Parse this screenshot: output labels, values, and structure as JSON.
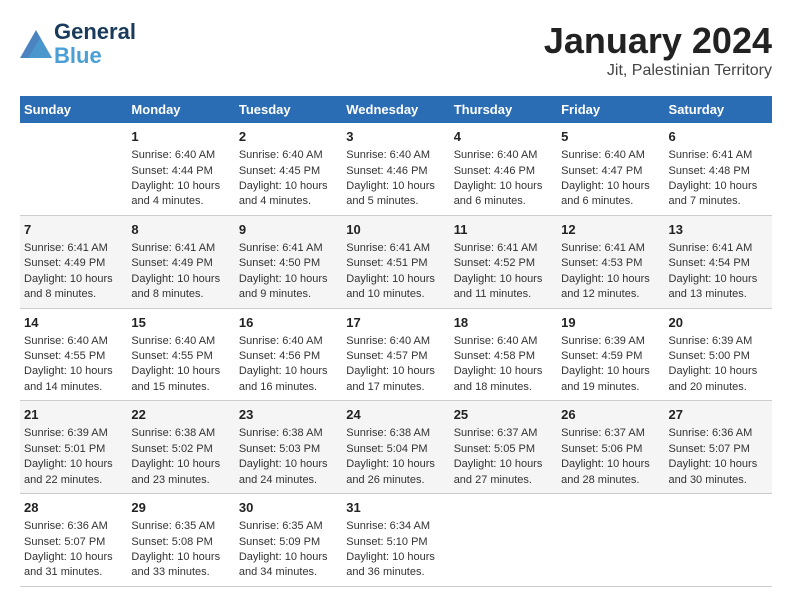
{
  "header": {
    "logo_line1": "General",
    "logo_line2": "Blue",
    "main_title": "January 2024",
    "subtitle": "Jit, Palestinian Territory"
  },
  "columns": [
    "Sunday",
    "Monday",
    "Tuesday",
    "Wednesday",
    "Thursday",
    "Friday",
    "Saturday"
  ],
  "weeks": [
    {
      "days": [
        {
          "num": "",
          "info": ""
        },
        {
          "num": "1",
          "info": "Sunrise: 6:40 AM\nSunset: 4:44 PM\nDaylight: 10 hours\nand 4 minutes."
        },
        {
          "num": "2",
          "info": "Sunrise: 6:40 AM\nSunset: 4:45 PM\nDaylight: 10 hours\nand 4 minutes."
        },
        {
          "num": "3",
          "info": "Sunrise: 6:40 AM\nSunset: 4:46 PM\nDaylight: 10 hours\nand 5 minutes."
        },
        {
          "num": "4",
          "info": "Sunrise: 6:40 AM\nSunset: 4:46 PM\nDaylight: 10 hours\nand 6 minutes."
        },
        {
          "num": "5",
          "info": "Sunrise: 6:40 AM\nSunset: 4:47 PM\nDaylight: 10 hours\nand 6 minutes."
        },
        {
          "num": "6",
          "info": "Sunrise: 6:41 AM\nSunset: 4:48 PM\nDaylight: 10 hours\nand 7 minutes."
        }
      ]
    },
    {
      "days": [
        {
          "num": "7",
          "info": "Sunrise: 6:41 AM\nSunset: 4:49 PM\nDaylight: 10 hours\nand 8 minutes."
        },
        {
          "num": "8",
          "info": "Sunrise: 6:41 AM\nSunset: 4:49 PM\nDaylight: 10 hours\nand 8 minutes."
        },
        {
          "num": "9",
          "info": "Sunrise: 6:41 AM\nSunset: 4:50 PM\nDaylight: 10 hours\nand 9 minutes."
        },
        {
          "num": "10",
          "info": "Sunrise: 6:41 AM\nSunset: 4:51 PM\nDaylight: 10 hours\nand 10 minutes."
        },
        {
          "num": "11",
          "info": "Sunrise: 6:41 AM\nSunset: 4:52 PM\nDaylight: 10 hours\nand 11 minutes."
        },
        {
          "num": "12",
          "info": "Sunrise: 6:41 AM\nSunset: 4:53 PM\nDaylight: 10 hours\nand 12 minutes."
        },
        {
          "num": "13",
          "info": "Sunrise: 6:41 AM\nSunset: 4:54 PM\nDaylight: 10 hours\nand 13 minutes."
        }
      ]
    },
    {
      "days": [
        {
          "num": "14",
          "info": "Sunrise: 6:40 AM\nSunset: 4:55 PM\nDaylight: 10 hours\nand 14 minutes."
        },
        {
          "num": "15",
          "info": "Sunrise: 6:40 AM\nSunset: 4:55 PM\nDaylight: 10 hours\nand 15 minutes."
        },
        {
          "num": "16",
          "info": "Sunrise: 6:40 AM\nSunset: 4:56 PM\nDaylight: 10 hours\nand 16 minutes."
        },
        {
          "num": "17",
          "info": "Sunrise: 6:40 AM\nSunset: 4:57 PM\nDaylight: 10 hours\nand 17 minutes."
        },
        {
          "num": "18",
          "info": "Sunrise: 6:40 AM\nSunset: 4:58 PM\nDaylight: 10 hours\nand 18 minutes."
        },
        {
          "num": "19",
          "info": "Sunrise: 6:39 AM\nSunset: 4:59 PM\nDaylight: 10 hours\nand 19 minutes."
        },
        {
          "num": "20",
          "info": "Sunrise: 6:39 AM\nSunset: 5:00 PM\nDaylight: 10 hours\nand 20 minutes."
        }
      ]
    },
    {
      "days": [
        {
          "num": "21",
          "info": "Sunrise: 6:39 AM\nSunset: 5:01 PM\nDaylight: 10 hours\nand 22 minutes."
        },
        {
          "num": "22",
          "info": "Sunrise: 6:38 AM\nSunset: 5:02 PM\nDaylight: 10 hours\nand 23 minutes."
        },
        {
          "num": "23",
          "info": "Sunrise: 6:38 AM\nSunset: 5:03 PM\nDaylight: 10 hours\nand 24 minutes."
        },
        {
          "num": "24",
          "info": "Sunrise: 6:38 AM\nSunset: 5:04 PM\nDaylight: 10 hours\nand 26 minutes."
        },
        {
          "num": "25",
          "info": "Sunrise: 6:37 AM\nSunset: 5:05 PM\nDaylight: 10 hours\nand 27 minutes."
        },
        {
          "num": "26",
          "info": "Sunrise: 6:37 AM\nSunset: 5:06 PM\nDaylight: 10 hours\nand 28 minutes."
        },
        {
          "num": "27",
          "info": "Sunrise: 6:36 AM\nSunset: 5:07 PM\nDaylight: 10 hours\nand 30 minutes."
        }
      ]
    },
    {
      "days": [
        {
          "num": "28",
          "info": "Sunrise: 6:36 AM\nSunset: 5:07 PM\nDaylight: 10 hours\nand 31 minutes."
        },
        {
          "num": "29",
          "info": "Sunrise: 6:35 AM\nSunset: 5:08 PM\nDaylight: 10 hours\nand 33 minutes."
        },
        {
          "num": "30",
          "info": "Sunrise: 6:35 AM\nSunset: 5:09 PM\nDaylight: 10 hours\nand 34 minutes."
        },
        {
          "num": "31",
          "info": "Sunrise: 6:34 AM\nSunset: 5:10 PM\nDaylight: 10 hours\nand 36 minutes."
        },
        {
          "num": "",
          "info": ""
        },
        {
          "num": "",
          "info": ""
        },
        {
          "num": "",
          "info": ""
        }
      ]
    }
  ]
}
